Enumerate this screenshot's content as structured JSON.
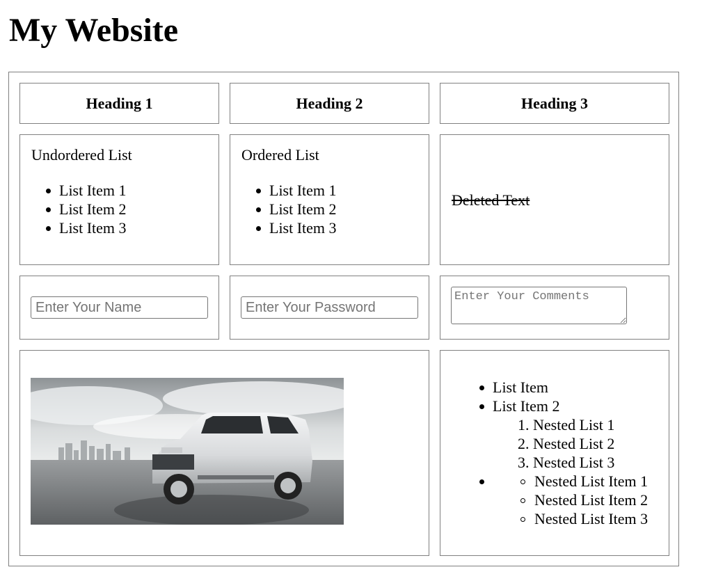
{
  "page": {
    "title": "My Website"
  },
  "headings": [
    "Heading 1",
    "Heading 2",
    "Heading 3"
  ],
  "unordered": {
    "title": "Undordered List",
    "items": [
      "List Item 1",
      "List Item 2",
      "List Item 3"
    ]
  },
  "ordered": {
    "title": "Ordered List",
    "items": [
      "List Item 1",
      "List Item 2",
      "List Item 3"
    ]
  },
  "deleted_text": "Deleted Text",
  "form": {
    "name_placeholder": "Enter Your Name",
    "password_placeholder": "Enter Your Password",
    "comments_placeholder": "Enter Your Comments"
  },
  "image": {
    "alt": "car"
  },
  "nested": {
    "item1": "List Item",
    "item2": "List Item 2",
    "ordered": [
      {
        "num": "1.",
        "label": "Nested List 1"
      },
      {
        "num": "2.",
        "label": "Nested List 2"
      },
      {
        "num": "3.",
        "label": "Nested List 3"
      }
    ],
    "unordered": [
      "Nested List Item 1",
      "Nested List Item 2",
      "Nested List Item 3"
    ]
  }
}
